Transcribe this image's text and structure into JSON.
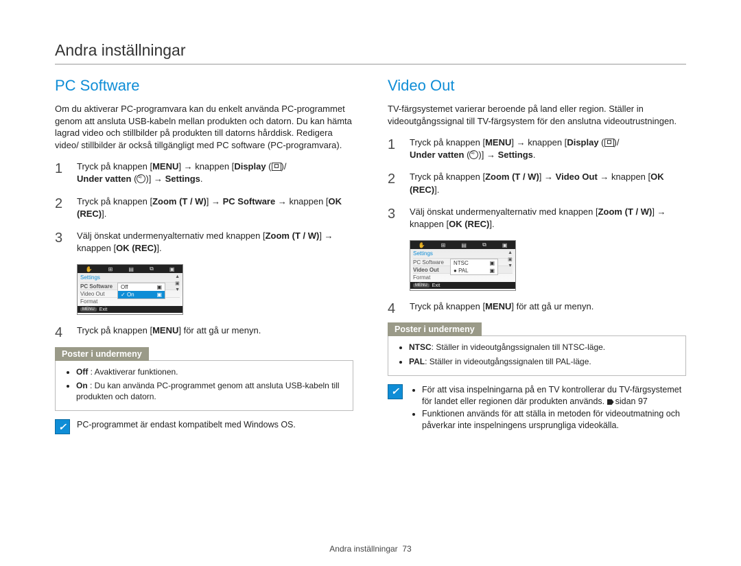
{
  "page": {
    "title": "Andra inställningar",
    "footer_label": "Andra inställningar",
    "page_number": "73"
  },
  "left": {
    "heading": "PC Software",
    "intro": "Om du aktiverar PC-programvara kan du enkelt använda PC-programmet genom att ansluta USB-kabeln mellan produkten och datorn. Du kan hämta lagrad video och stillbilder på produkten till datorns hårddisk. Redigera video/ stillbilder är också tillgängligt med PC software (PC-programvara).",
    "steps": {
      "s1_a": "Tryck på knappen [",
      "s1_menu": "MENU",
      "s1_b": "] → knappen [",
      "s1_display": "Display",
      "s1_c": " (",
      "s1_d": ")/",
      "s1_under": "Under vatten",
      "s1_e": " (",
      "s1_f": ")] → ",
      "s1_settings": "Settings",
      "s1_g": ".",
      "s2_a": "Tryck på knappen [",
      "s2_zoom": "Zoom",
      "s2_tw": " (T / W)",
      "s2_b": "] → ",
      "s2_target": "PC Software",
      "s2_c": " → knappen [",
      "s2_ok": "OK (REC)",
      "s2_d": "].",
      "s3_a": "Välj önskat undermenyalternativ med knappen [",
      "s3_zoom": "Zoom",
      "s3_tw": " (T / W)",
      "s3_b": "] → knappen [",
      "s3_ok": "OK (REC)",
      "s3_c": "].",
      "s4_a": "Tryck på knappen [",
      "s4_menu": "MENU",
      "s4_b": "] för att gå ur menyn."
    },
    "ui": {
      "settings": "Settings",
      "row_pc": "PC Software",
      "row_video": "Video Out",
      "row_format": "Format",
      "popup_off": "Off",
      "popup_on": "On",
      "exit_tag": "MENU",
      "exit": "Exit"
    },
    "submenu_header": "Poster i undermeny",
    "submenu": {
      "off_label": "Off",
      "off_text": " : Avaktiverar funktionen.",
      "on_label": "On",
      "on_text": " : Du kan använda PC-programmet genom att ansluta USB-kabeln till produkten och datorn."
    },
    "note": "PC-programmet är endast kompatibelt med Windows OS."
  },
  "right": {
    "heading": "Video Out",
    "intro": "TV-färgsystemet varierar beroende på land eller region. Ställer in videoutgångssignal till TV-färgsystem för den anslutna videoutrustningen.",
    "steps": {
      "s1_a": "Tryck på knappen [",
      "s1_menu": "MENU",
      "s1_b": "] → knappen [",
      "s1_display": "Display",
      "s1_c": " (",
      "s1_d": ")/",
      "s1_under": "Under vatten",
      "s1_e": " (",
      "s1_f": ")] → ",
      "s1_settings": "Settings",
      "s1_g": ".",
      "s2_a": "Tryck på knappen [",
      "s2_zoom": "Zoom",
      "s2_tw": " (T / W)",
      "s2_b": "] → ",
      "s2_target": "Video Out",
      "s2_c": " → knappen [",
      "s2_ok": "OK (REC)",
      "s2_d": "].",
      "s3_a": "Välj önskat undermenyalternativ med knappen [",
      "s3_zoom": "Zoom",
      "s3_tw": " (T / W)",
      "s3_b": "] → knappen [",
      "s3_ok": "OK (REC)",
      "s3_c": "].",
      "s4_a": "Tryck på knappen [",
      "s4_menu": "MENU",
      "s4_b": "] för att gå ur menyn."
    },
    "ui": {
      "settings": "Settings",
      "row_pc": "PC Software",
      "row_video": "Video Out",
      "row_format": "Format",
      "popup_ntsc": "NTSC",
      "popup_pal": "PAL",
      "exit_tag": "MENU",
      "exit": "Exit"
    },
    "submenu_header": "Poster i undermeny",
    "submenu": {
      "ntsc_label": "NTSC",
      "ntsc_text": ": Ställer in videoutgångssignalen till NTSC-läge.",
      "pal_label": "PAL",
      "pal_text": ": Ställer in videoutgångssignalen till PAL-läge."
    },
    "note1": "För att visa inspelningarna på en TV kontrollerar du TV-färgsystemet för landet eller regionen där produkten används. ",
    "note1_pageref": "sidan 97",
    "note2": "Funktionen används för att ställa in metoden för videoutmatning och påverkar inte inspelningens ursprungliga videokälla."
  }
}
